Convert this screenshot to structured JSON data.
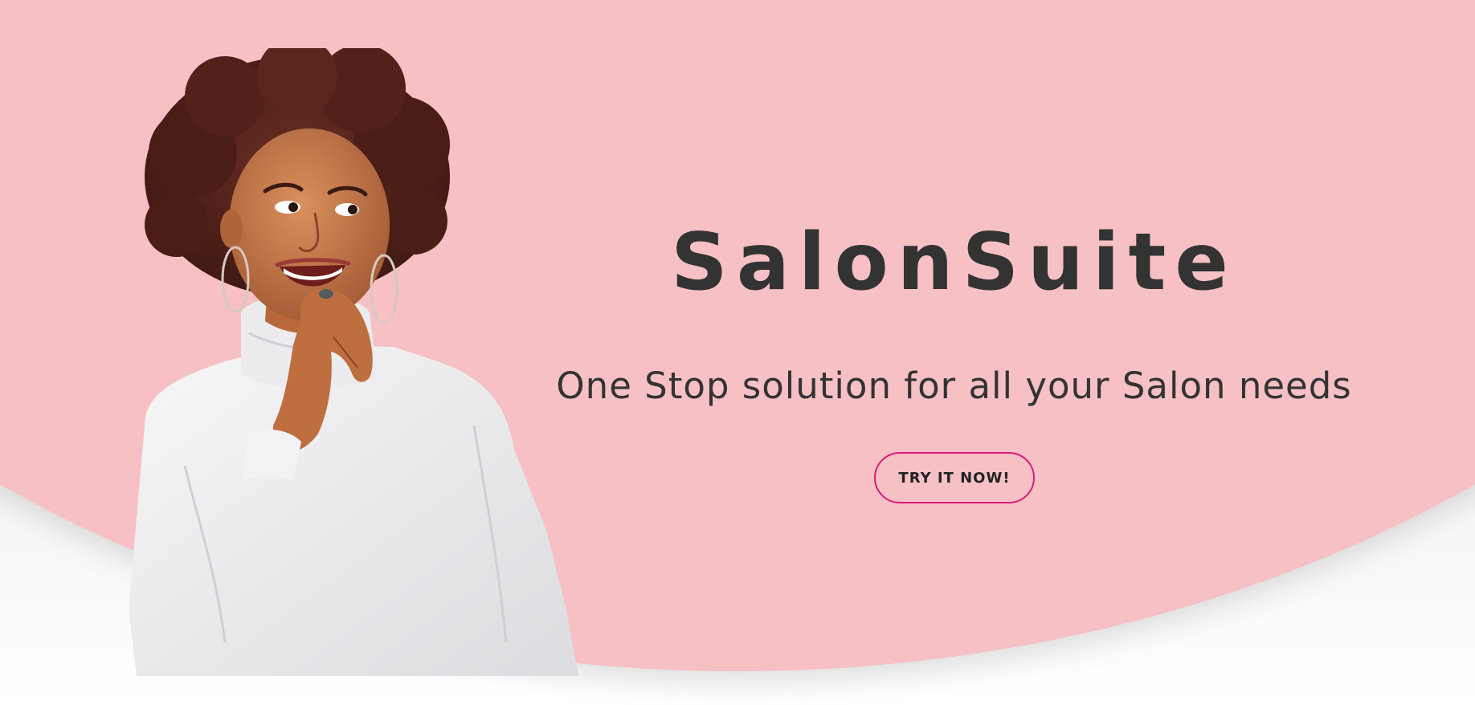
{
  "hero": {
    "title": "SalonSuite",
    "tagline": "One Stop solution for all your Salon needs",
    "cta_label": "TRY IT NOW!",
    "image": "smiling-woman-portrait"
  },
  "colors": {
    "hero_background": "#f7c0c5",
    "text": "#333333",
    "cta_border": "#d81b7a"
  }
}
